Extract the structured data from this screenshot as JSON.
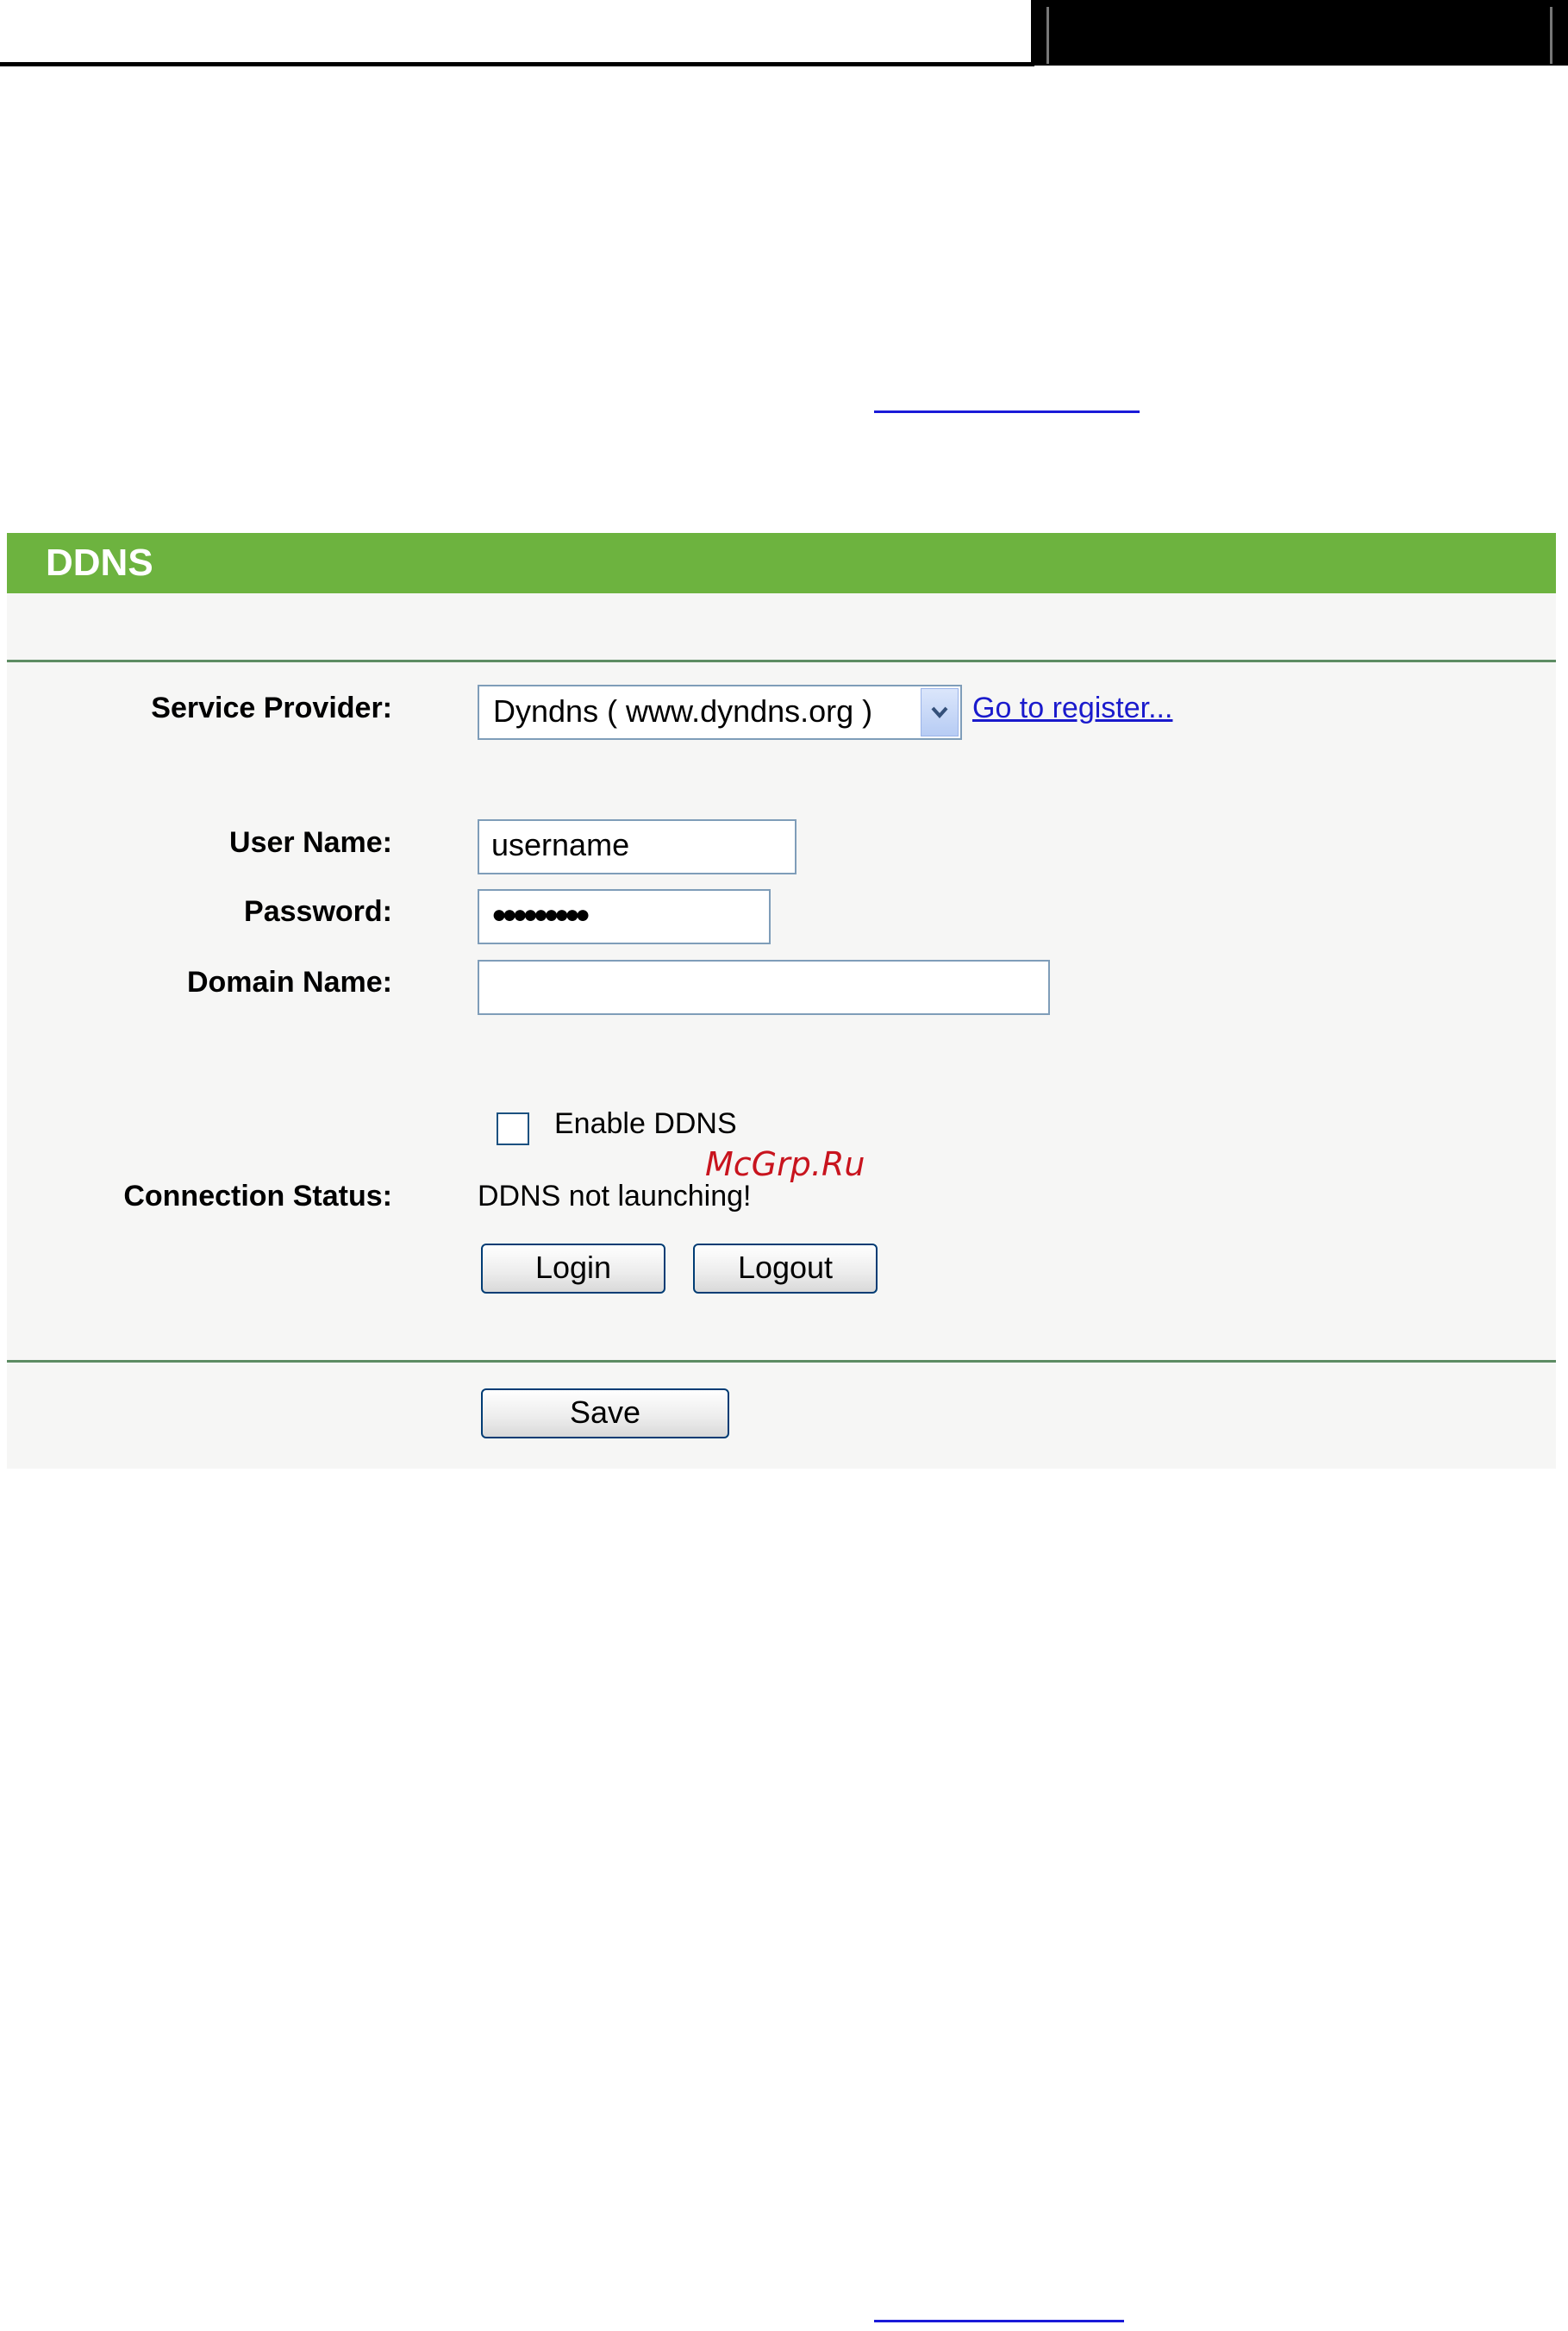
{
  "panel": {
    "title": "DDNS"
  },
  "form": {
    "service_provider": {
      "label": "Service Provider:",
      "selected": "Dyndns ( www.dyndns.org )",
      "register_link": "Go to register..."
    },
    "user_name": {
      "label": "User Name:",
      "value": "username"
    },
    "password": {
      "label": "Password:",
      "masked_value": "●●●●●●●●●"
    },
    "domain_name": {
      "label": "Domain Name:",
      "value": ""
    },
    "enable_ddns": {
      "label": "Enable DDNS",
      "checked": false
    },
    "connection_status": {
      "label": "Connection Status:",
      "value": "DDNS not launching!"
    },
    "buttons": {
      "login": "Login",
      "logout": "Logout",
      "save": "Save"
    }
  },
  "watermark": "McGrp.Ru",
  "colors": {
    "header_green": "#6db33f",
    "panel_bg": "#f6f6f5",
    "separator": "#5d8c63",
    "link": "#1a1acc"
  }
}
